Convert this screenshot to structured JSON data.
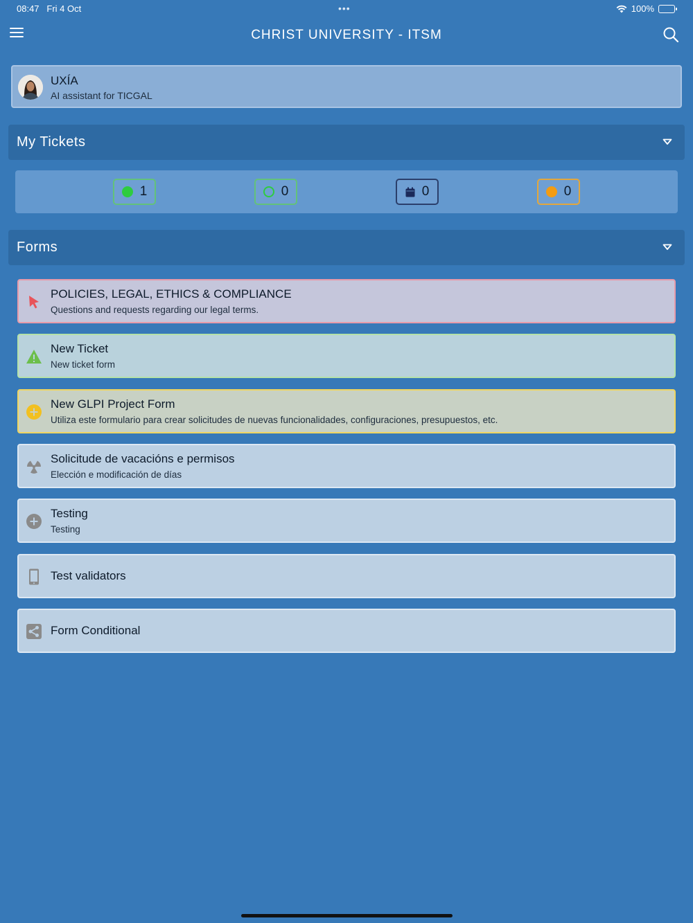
{
  "status_bar": {
    "time": "08:47",
    "date": "Fri 4 Oct",
    "dots": "•••",
    "battery": "100%"
  },
  "header": {
    "title": "CHRIST UNIVERSITY - ITSM"
  },
  "assistant": {
    "name": "UXÍA",
    "subtitle": "AI assistant for TICGAL"
  },
  "my_tickets": {
    "title": "My Tickets",
    "counters": [
      {
        "value": "1",
        "icon": "green-filled-circle-icon",
        "color": "#2ecc40"
      },
      {
        "value": "0",
        "icon": "green-outline-circle-icon",
        "color": "#2ecc40"
      },
      {
        "value": "0",
        "icon": "calendar-icon",
        "color": "#1b2a5a"
      },
      {
        "value": "0",
        "icon": "orange-filled-circle-icon",
        "color": "#f39c12"
      }
    ]
  },
  "forms": {
    "title": "Forms",
    "items": [
      {
        "title": "POLICIES, LEGAL, ETHICS & COMPLIANCE",
        "description": "Questions and requests regarding our legal terms.",
        "icon": "cursor-pointer-icon",
        "color": "#e8545a"
      },
      {
        "title": "New Ticket",
        "description": "New ticket form",
        "icon": "warning-triangle-icon",
        "color": "#6cbf4b"
      },
      {
        "title": "New GLPI Project Form",
        "description": "Utiliza este formulario para crear solicitudes de nuevas funcionalidades, configuraciones, presupuestos, etc.",
        "icon": "plus-circle-icon",
        "color": "#f2c01f"
      },
      {
        "title": "Solicitude de vacacións e permisos",
        "description": "Elección e modificación de días",
        "icon": "radiation-icon",
        "color": "#8a8a8a"
      },
      {
        "title": "Testing",
        "description": "Testing",
        "icon": "plus-circle-icon",
        "color": "#8a8a8a"
      },
      {
        "title": "Test validators",
        "description": "",
        "icon": "mobile-phone-icon",
        "color": "#8a8a8a"
      },
      {
        "title": "Form Conditional",
        "description": "",
        "icon": "share-icon",
        "color": "#8a8a8a"
      }
    ]
  }
}
